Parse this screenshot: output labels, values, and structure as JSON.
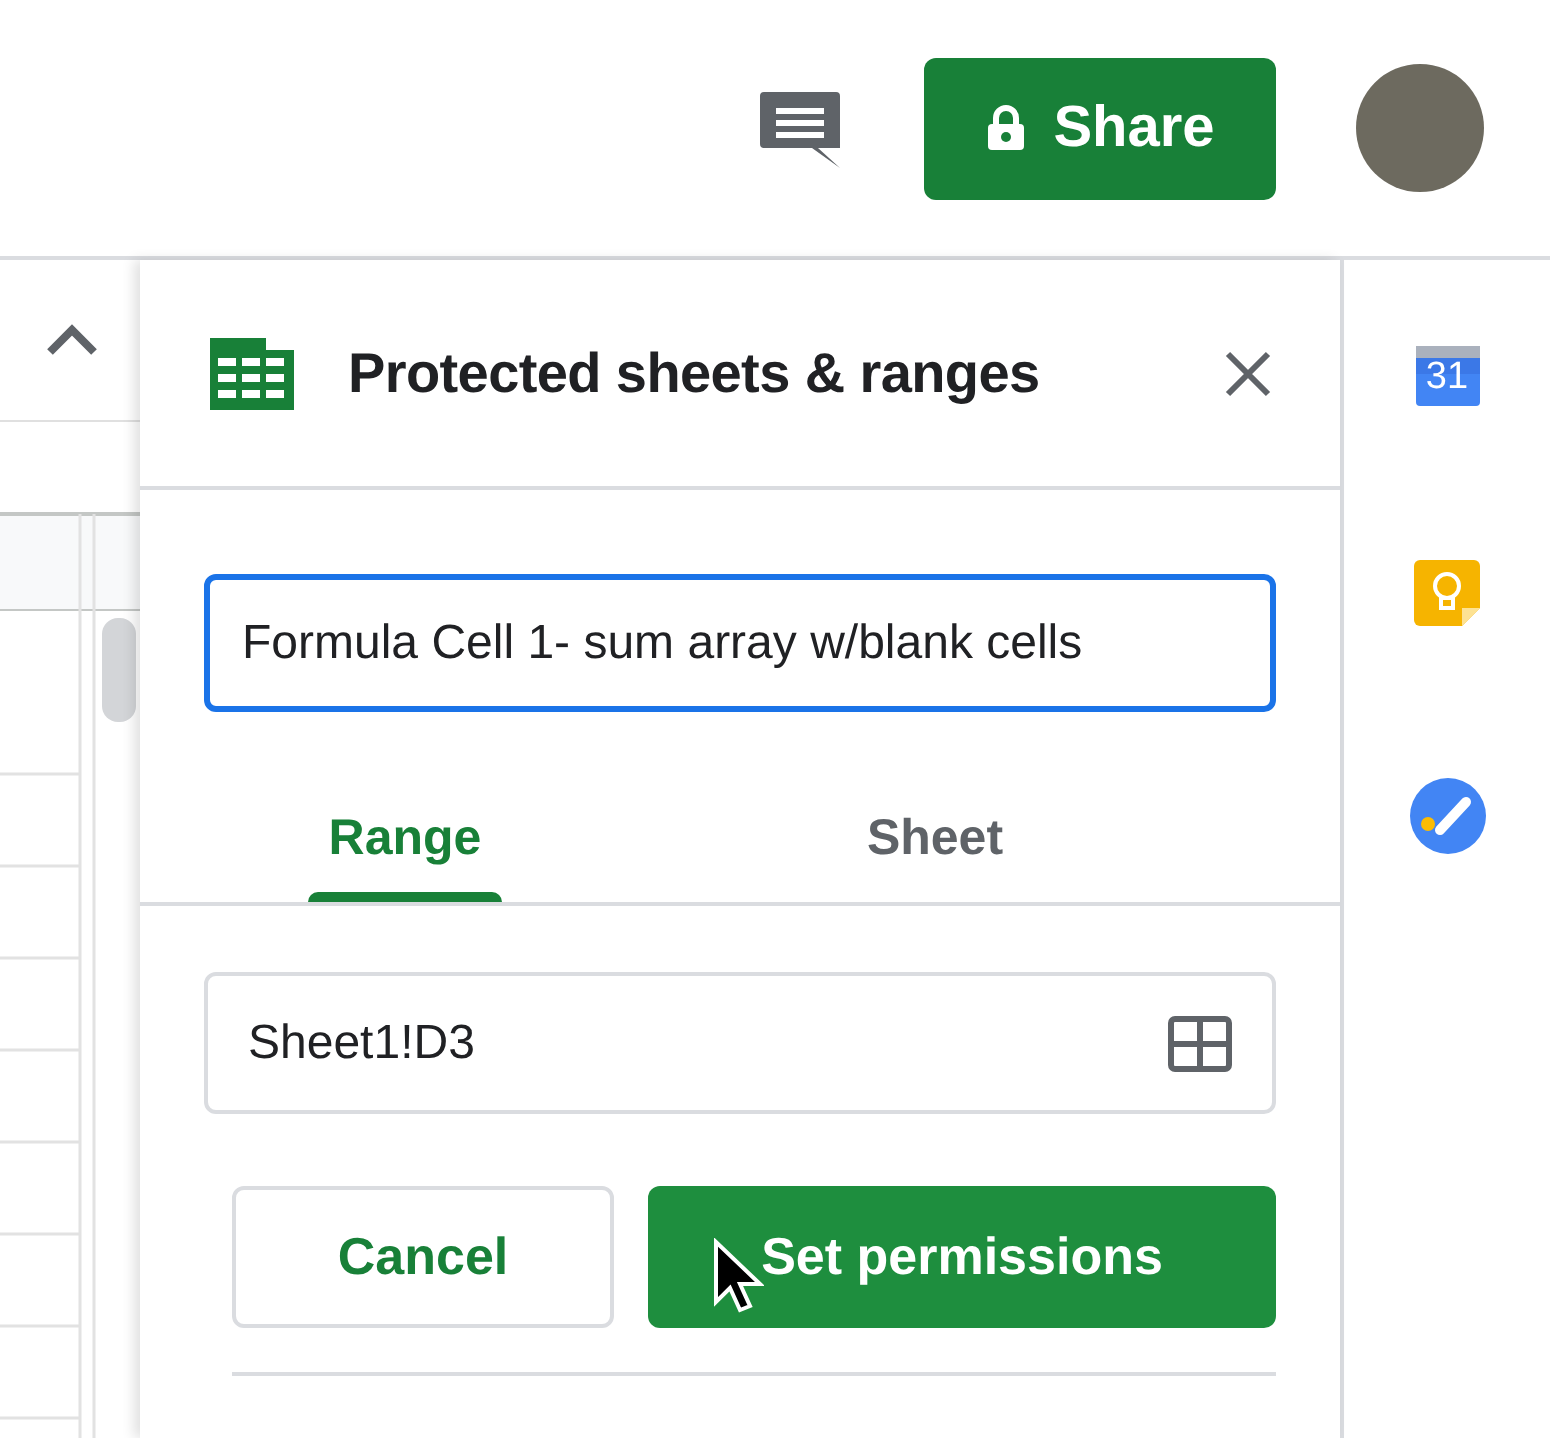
{
  "toolbar": {
    "share_button": {
      "label": "Share"
    }
  },
  "panel": {
    "title": "Protected sheets & ranges",
    "description": {
      "value": "Formula Cell 1- sum array w/blank cells",
      "focused": true
    },
    "tabs": [
      {
        "label": "Range",
        "selected": true
      },
      {
        "label": "Sheet",
        "selected": false
      }
    ],
    "range": {
      "value": "Sheet1!D3"
    },
    "buttons": [
      {
        "label": "Cancel",
        "kind": "secondary"
      },
      {
        "label": "Set permissions",
        "kind": "primary"
      }
    ]
  },
  "side_panel": {
    "apps": [
      {
        "kind": "calendar",
        "label": "31"
      },
      {
        "kind": "keep"
      },
      {
        "kind": "tasks"
      }
    ]
  }
}
